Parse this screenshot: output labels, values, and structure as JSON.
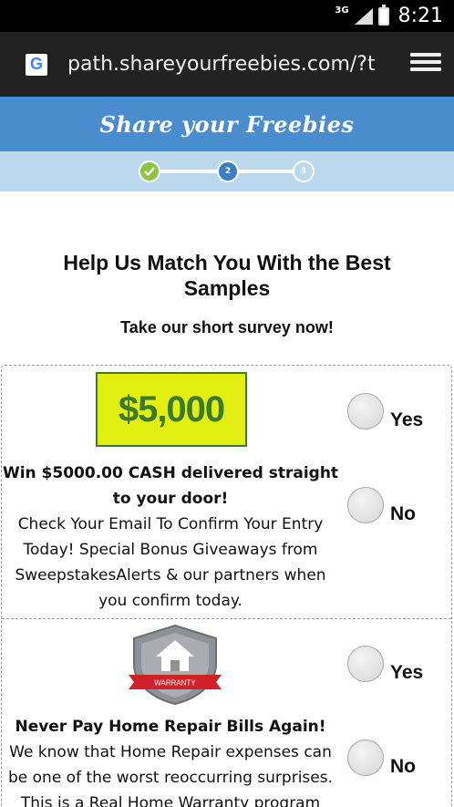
{
  "status_bar": {
    "network": "3G",
    "time": "8:21"
  },
  "browser": {
    "url": "path.shareyourfreebies.com/?t",
    "favicon": "G",
    "tabs_icon": "tabs-icon"
  },
  "site": {
    "logo_text": "Share your Freebies"
  },
  "progress": {
    "steps": [
      {
        "label": "✓",
        "state": "complete"
      },
      {
        "label": "2",
        "state": "current"
      },
      {
        "label": "3",
        "state": "upcoming"
      }
    ]
  },
  "page": {
    "heading": "Help Us Match You With the Best Samples",
    "subheading": "Take our short survey now!"
  },
  "offers": [
    {
      "image_text": "$5,000",
      "title": "Win $5000.00 CASH delivered straight to your door!",
      "description": "Check Your Email To Confirm Your Entry Today! Special Bonus Giveaways from SweepstakesAlerts & our partners when you confirm today.",
      "yes_label": "Yes",
      "no_label": "No"
    },
    {
      "image_text": "WARRANTY",
      "title": "Never Pay Home Repair Bills Again!",
      "description": "We know that Home Repair expenses can be one of the worst reoccurring surprises. This is a Real Home Warranty program",
      "yes_label": "Yes",
      "no_label": "No"
    }
  ],
  "colors": {
    "header_blue": "#4a8dcf",
    "progress_bg": "#bcd8ef",
    "step_complete": "#8cc63f",
    "step_current": "#3a7fc0",
    "prize_bg": "#e3ef13",
    "prize_text": "#3a7a29",
    "ribbon_red": "#d0202a"
  }
}
